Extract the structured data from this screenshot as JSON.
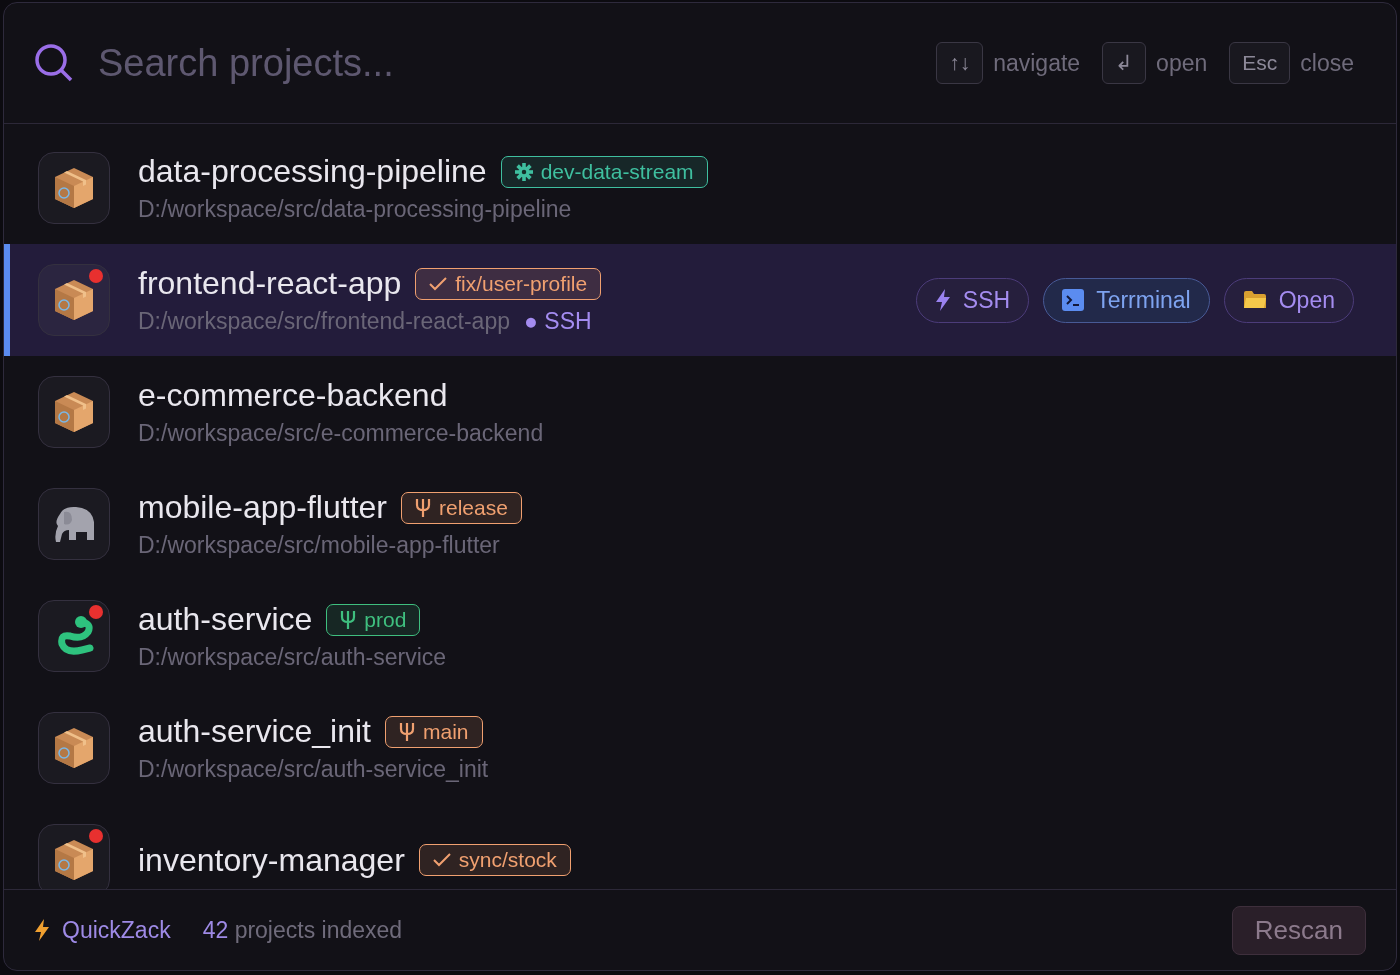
{
  "search": {
    "placeholder": "Search projects..."
  },
  "hints": [
    {
      "keys": "↑↓",
      "label": "navigate"
    },
    {
      "keys": "↲",
      "label": "open"
    },
    {
      "keys": "Esc",
      "label": "close"
    }
  ],
  "projects": [
    {
      "name": "data-processing-pipeline",
      "path": "D:/workspace/src/data-processing-pipeline",
      "kind": "box",
      "alert": false,
      "selected": false,
      "badge": {
        "text": "dev-data-stream",
        "kind": "gear",
        "color": "#3fbf9f"
      }
    },
    {
      "name": "frontend-react-app",
      "path": "D:/workspace/src/frontend-react-app",
      "kind": "box",
      "alert": true,
      "selected": true,
      "remote_dot": "●",
      "remote": "SSH",
      "badge": {
        "text": "fix/user-profile",
        "kind": "check",
        "color": "#f0a070"
      },
      "actions": [
        {
          "label": "SSH",
          "kind": "bolt"
        },
        {
          "label": "Terrminal",
          "kind": "terminal"
        },
        {
          "label": "Open",
          "kind": "folder"
        }
      ]
    },
    {
      "name": "e-commerce-backend",
      "path": "D:/workspace/src/e-commerce-backend",
      "kind": "box",
      "alert": false,
      "selected": false
    },
    {
      "name": "mobile-app-flutter",
      "path": "D:/workspace/src/mobile-app-flutter",
      "kind": "elephant",
      "alert": false,
      "selected": false,
      "badge": {
        "text": "release",
        "kind": "branch",
        "color": "#f0a070"
      }
    },
    {
      "name": "auth-service",
      "path": "D:/workspace/src/auth-service",
      "kind": "snake",
      "alert": true,
      "selected": false,
      "badge": {
        "text": "prod",
        "kind": "branch",
        "color": "#3fbf7f"
      }
    },
    {
      "name": "auth-service_init",
      "path": "D:/workspace/src/auth-service_init",
      "kind": "box",
      "alert": false,
      "selected": false,
      "badge": {
        "text": "main",
        "kind": "branch",
        "color": "#f0a070"
      }
    },
    {
      "name": "inventory-manager",
      "kind": "box",
      "alert": true,
      "selected": false,
      "badge": {
        "text": "sync/stock",
        "kind": "check",
        "color": "#f0a070"
      }
    }
  ],
  "footer": {
    "brand": "QuickZack",
    "count": "42",
    "count_label": "projects indexed",
    "button": "Rescan"
  }
}
